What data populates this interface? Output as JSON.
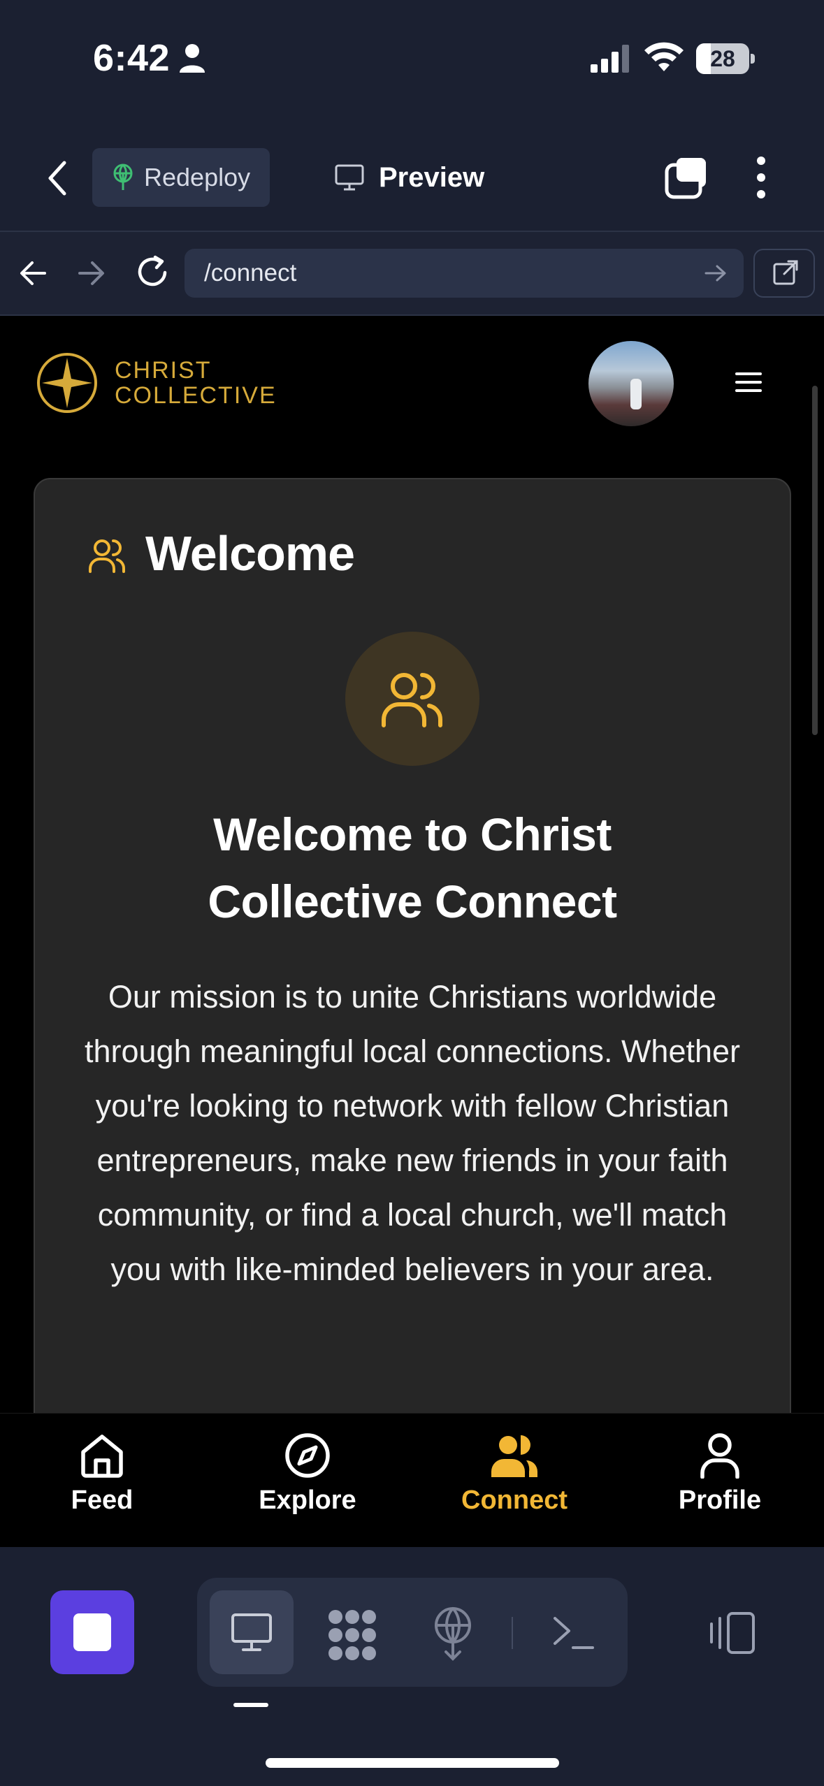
{
  "status_bar": {
    "time": "6:42",
    "battery_level": "28"
  },
  "toolbar": {
    "redeploy_label": "Redeploy",
    "preview_label": "Preview"
  },
  "browser": {
    "url": "/connect"
  },
  "site": {
    "logo_line1": "CHRIST",
    "logo_line2": "COLLECTIVE",
    "brand_color": "#d6aa3a",
    "accent_color": "#f2b735"
  },
  "welcome_card": {
    "title": "Welcome",
    "headline": "Welcome to Christ Collective Connect",
    "mission": "Our mission is to unite Christians worldwide through meaningful local connections. Whether you're looking to network with fellow Christian entrepreneurs, make new friends in your faith community, or find a local church, we'll match you with like-minded believers in your area."
  },
  "app_nav": {
    "items": [
      {
        "label": "Feed",
        "icon": "home-icon"
      },
      {
        "label": "Explore",
        "icon": "compass-icon"
      },
      {
        "label": "Connect",
        "icon": "users-icon",
        "active": true
      },
      {
        "label": "Profile",
        "icon": "user-icon"
      }
    ]
  },
  "ide_bar": {
    "stop_color": "#5b3fe0",
    "modes": [
      "desktop-icon",
      "nodes-icon",
      "deploy-icon",
      "console-icon"
    ],
    "active_mode": "desktop-icon"
  }
}
